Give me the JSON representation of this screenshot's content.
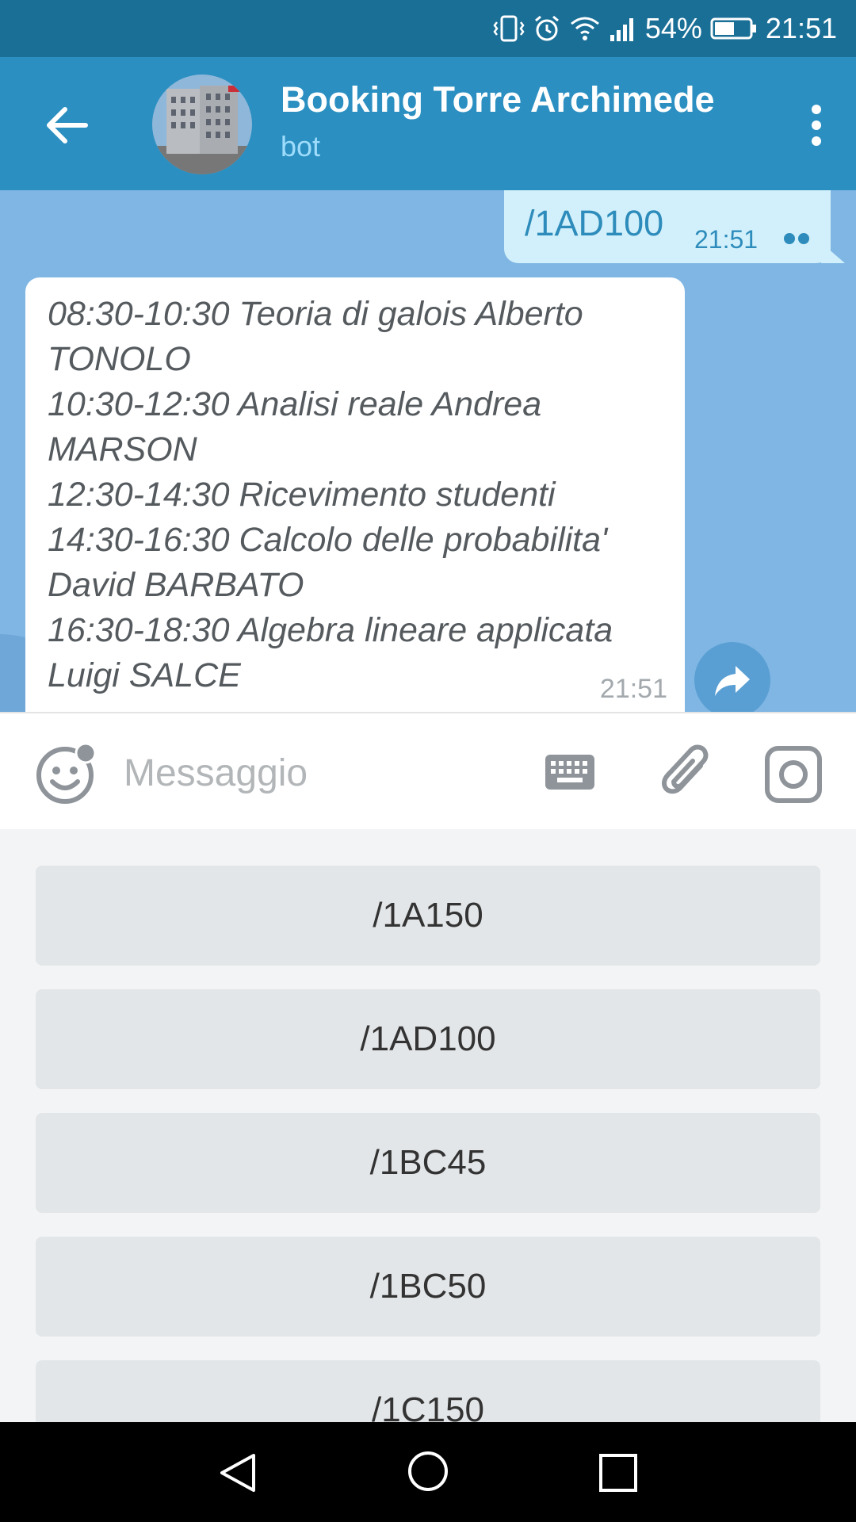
{
  "status_bar": {
    "battery": "54%",
    "time": "21:51"
  },
  "header": {
    "title": "Booking Torre Archimede",
    "subtitle": "bot"
  },
  "messages": {
    "outgoing": {
      "text": "/1AD100",
      "time": "21:51"
    },
    "incoming": {
      "lines": [
        "08:30-10:30 Teoria di galois Alberto TONOLO",
        "10:30-12:30 Analisi reale Andrea MARSON",
        "12:30-14:30 Ricevimento studenti",
        "14:30-16:30 Calcolo delle probabilita' David BARBATO",
        "16:30-18:30 Algebra lineare applicata Luigi SALCE"
      ],
      "time": "21:51"
    }
  },
  "input": {
    "placeholder": "Messaggio",
    "value": ""
  },
  "bot_keyboard": {
    "buttons": [
      "/1A150",
      "/1AD100",
      "/1BC45",
      "/1BC50",
      "/1C150"
    ]
  },
  "colors": {
    "status_bar": "#1a6f97",
    "app_bar": "#2b8fc1",
    "chat_background": "#7fb6e4",
    "outgoing_bubble": "#d2f0fb",
    "keyboard_button": "#e3e6e8"
  },
  "icons": {
    "back": "arrow-left-icon",
    "menu": "more-vertical-icon",
    "share": "share-arrow-icon",
    "emoji": "smile-icon",
    "keyboard": "keyboard-icon",
    "attach": "paperclip-icon",
    "camera": "instagram-camera-icon"
  }
}
